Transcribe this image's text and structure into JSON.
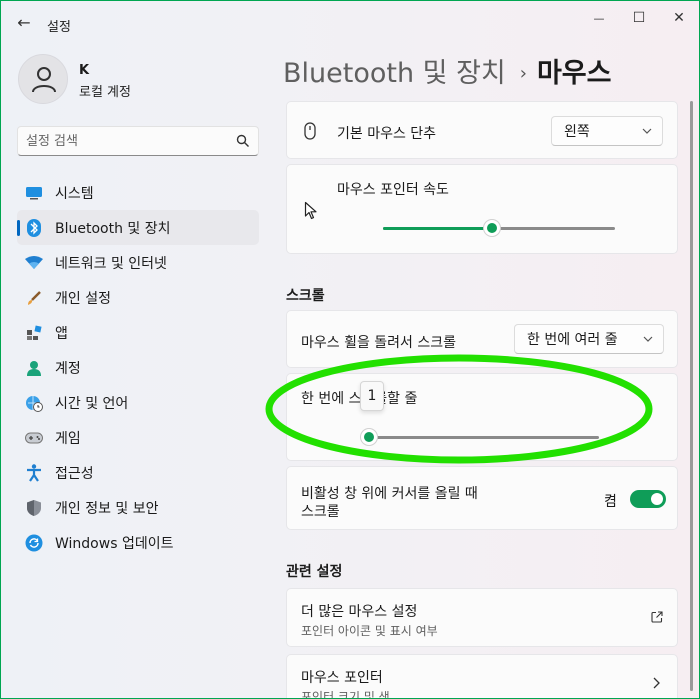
{
  "window": {
    "title": "설정",
    "controls": {
      "back": "←",
      "minimize": "—",
      "maximize": "☐",
      "close": "✕"
    }
  },
  "profile": {
    "name": "K",
    "account_type": "로컬 계정"
  },
  "search": {
    "placeholder": "설정 검색"
  },
  "nav": {
    "items": [
      {
        "label": "시스템",
        "icon": "system-icon"
      },
      {
        "label": "Bluetooth 및 장치",
        "icon": "bluetooth-icon",
        "active": true
      },
      {
        "label": "네트워크 및 인터넷",
        "icon": "wifi-icon"
      },
      {
        "label": "개인 설정",
        "icon": "brush-icon"
      },
      {
        "label": "앱",
        "icon": "apps-icon"
      },
      {
        "label": "계정",
        "icon": "account-icon"
      },
      {
        "label": "시간 및 언어",
        "icon": "clock-globe-icon"
      },
      {
        "label": "게임",
        "icon": "gamepad-icon"
      },
      {
        "label": "접근성",
        "icon": "accessibility-icon"
      },
      {
        "label": "개인 정보 및 보안",
        "icon": "shield-icon"
      },
      {
        "label": "Windows 업데이트",
        "icon": "update-icon"
      }
    ]
  },
  "header": {
    "parent": "Bluetooth 및 장치",
    "separator": "›",
    "current": "마우스"
  },
  "settings": {
    "primary_button": {
      "label": "기본 마우스 단추",
      "value": "왼쪽"
    },
    "pointer_speed": {
      "label": "마우스 포인터 속도",
      "level": 0.47
    },
    "scroll_section": "스크롤",
    "wheel_scroll": {
      "label": "마우스 휠을 돌려서 스크롤",
      "value": "한 번에 여러 줄"
    },
    "lines_to_scroll": {
      "label": "한 번에 스크롤할 줄",
      "value": "1",
      "level": 0.0
    },
    "inactive_scroll": {
      "label_line1": "비활성 창 위에 커서를 올릴 때",
      "label_line2": "스크롤",
      "state": "켬"
    },
    "related_section": "관련 설정",
    "more_mouse": {
      "title": "더 많은 마우스 설정",
      "subtitle": "포인터 아이콘 및 표시 여부"
    },
    "mouse_pointer": {
      "title": "마우스 포인터",
      "subtitle": "포인터 크기 및 색"
    }
  },
  "colors": {
    "accent": "#0f9d58",
    "annotation": "#22e000",
    "frame": "#00a651"
  }
}
